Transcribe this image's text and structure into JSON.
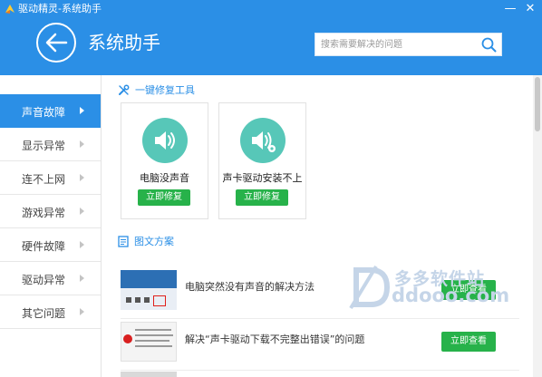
{
  "window": {
    "app_title": "驱动精灵-系统助手",
    "minimize_glyph": "—",
    "close_glyph": "✕"
  },
  "header": {
    "page_title": "系统助手",
    "search": {
      "placeholder": "搜索需要解决的问题",
      "value": ""
    }
  },
  "sidebar": {
    "items": [
      {
        "label": "声音故障",
        "active": true
      },
      {
        "label": "显示异常",
        "active": false
      },
      {
        "label": "连不上网",
        "active": false
      },
      {
        "label": "游戏异常",
        "active": false
      },
      {
        "label": "硬件故障",
        "active": false
      },
      {
        "label": "驱动异常",
        "active": false
      },
      {
        "label": "其它问题",
        "active": false
      }
    ]
  },
  "tools": {
    "section_title": "一键修复工具",
    "cards": [
      {
        "name": "电脑没声音",
        "button": "立即修复",
        "icon": "speaker-icon"
      },
      {
        "name": "声卡驱动安装不上",
        "button": "立即修复",
        "icon": "speaker-gear-icon"
      }
    ]
  },
  "docs": {
    "section_title": "图文方案",
    "articles": [
      {
        "title": "电脑突然没有声音的解决方法",
        "button": "立即查看"
      },
      {
        "title": "解决“声卡驱动下载不完整出错误”的问题",
        "button": "立即查看"
      }
    ]
  },
  "watermark": {
    "text": "多多软件站",
    "url": "ddooo.com"
  },
  "colors": {
    "header_blue": "#2b8fe6",
    "action_green": "#27b24a",
    "tool_icon_teal": "#57c7b8"
  }
}
